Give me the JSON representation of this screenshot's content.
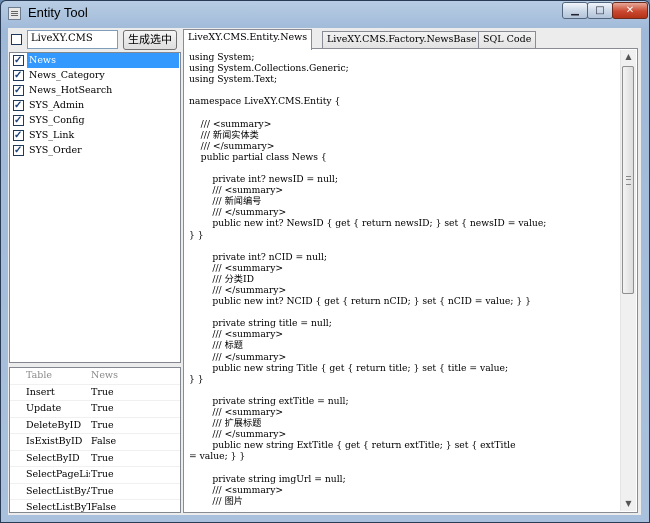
{
  "window": {
    "title": "Entity Tool"
  },
  "controls": {
    "minimize": "▁",
    "maximize": "□",
    "close": "✕"
  },
  "toolbar": {
    "namespace_value": "LiveXY.CMS",
    "select_button": "生成选中"
  },
  "class_list": [
    {
      "label": "News",
      "checked": true,
      "selected": true
    },
    {
      "label": "News_Category",
      "checked": true,
      "selected": false
    },
    {
      "label": "News_HotSearch",
      "checked": true,
      "selected": false
    },
    {
      "label": "SYS_Admin",
      "checked": true,
      "selected": false
    },
    {
      "label": "SYS_Config",
      "checked": true,
      "selected": false
    },
    {
      "label": "SYS_Link",
      "checked": true,
      "selected": false
    },
    {
      "label": "SYS_Order",
      "checked": true,
      "selected": false
    }
  ],
  "grid": {
    "header": {
      "col1": "Table",
      "col2": "News"
    },
    "rows": [
      {
        "col1": "Insert",
        "col2": "True"
      },
      {
        "col1": "Update",
        "col2": "True"
      },
      {
        "col1": "DeleteByID",
        "col2": "True"
      },
      {
        "col1": "IsExistByID",
        "col2": "False"
      },
      {
        "col1": "SelectByID",
        "col2": "True"
      },
      {
        "col1": "SelectPageList",
        "col2": "True"
      },
      {
        "col1": "SelectListByAll",
        "col2": "True"
      },
      {
        "col1": "SelectListByTop",
        "col2": "False"
      }
    ]
  },
  "tabs": [
    "LiveXY.CMS.Entity.News",
    "LiveXY.CMS.Factory.NewsBase",
    "SQL Code"
  ],
  "code_lines": [
    "using System;",
    "using System.Collections.Generic;",
    "using System.Text;",
    "",
    "namespace LiveXY.CMS.Entity {",
    "",
    "    /// <summary>",
    "    /// 新闻实体类",
    "    /// </summary>",
    "    public partial class News {",
    "",
    "        private int? newsID = null;",
    "        /// <summary>",
    "        /// 新闻编号",
    "        /// </summary>",
    "        public new int? NewsID { get { return newsID; } set { newsID = value;",
    "} }",
    "",
    "        private int? nCID = null;",
    "        /// <summary>",
    "        /// 分类ID",
    "        /// </summary>",
    "        public new int? NCID { get { return nCID; } set { nCID = value; } }",
    "",
    "        private string title = null;",
    "        /// <summary>",
    "        /// 标题",
    "        /// </summary>",
    "        public new string Title { get { return title; } set { title = value;",
    "} }",
    "",
    "        private string extTitle = null;",
    "        /// <summary>",
    "        /// 扩展标题",
    "        /// </summary>",
    "        public new string ExtTitle { get { return extTitle; } set { extTitle",
    "= value; } }",
    "",
    "        private string imgUrl = null;",
    "        /// <summary>",
    "        /// 图片"
  ],
  "scrollbar": {
    "up": "▲",
    "down": "▼"
  }
}
